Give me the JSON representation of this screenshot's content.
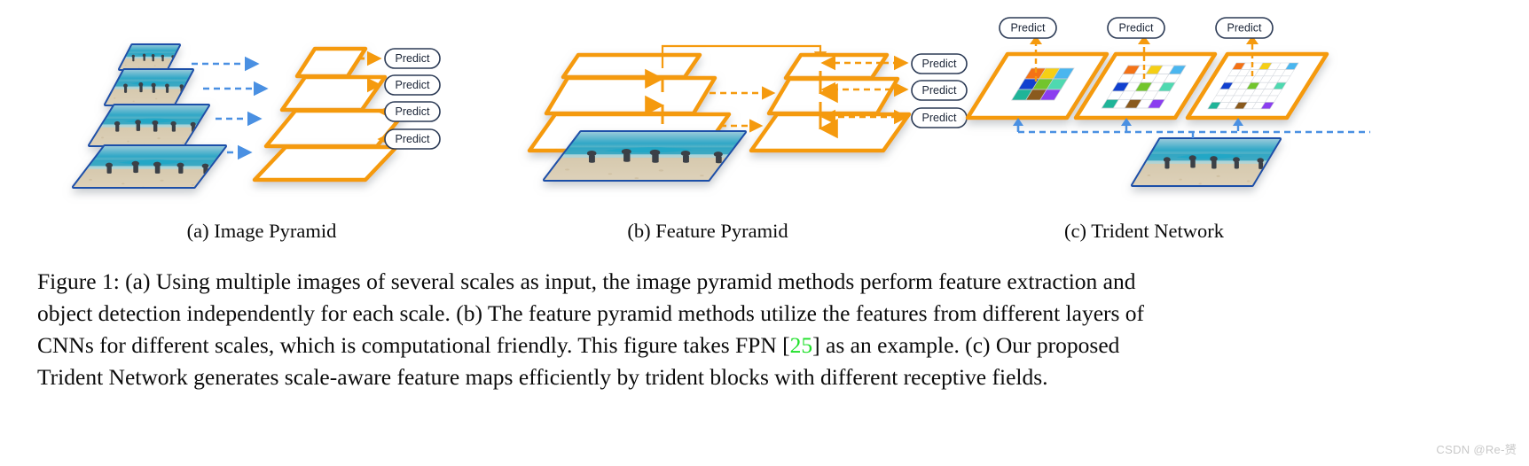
{
  "figure": {
    "subcaptions": [
      {
        "id": "a",
        "label": "(a) Image Pyramid"
      },
      {
        "id": "b",
        "label": "(b) Feature Pyramid"
      },
      {
        "id": "c",
        "label": "(c) Trident Network"
      }
    ],
    "caption": {
      "lines": [
        "Figure 1:  (a) Using multiple images of several scales as input, the image pyramid methods perform feature extraction and",
        "object detection independently for each scale.  (b) The feature pyramid methods utilize the features from different layers of",
        "CNNs for different scales, which is computational friendly.  This figure takes FPN [#CITE#] as an example.  (c) Our proposed",
        "Trident Network generates scale-aware feature maps efficiently by trident blocks with different receptive fields."
      ],
      "citation": "25",
      "citation_color": "#1fe02a"
    },
    "watermark": "CSDN @Re-赟",
    "predict_label": "Predict",
    "colors": {
      "image_plane_border": "#1f4fa8",
      "image_plane_border_dark": "#163f8c",
      "feature_plane_border": "#f59a0e",
      "feature_plane_fill": "#ffffff",
      "blue_arrow": "#4a90e2",
      "orange_arrow": "#f59a0e",
      "predict_border": "#2b3a55",
      "predict_text": "#1c2638",
      "grid_line": "#c9cdd4",
      "sand": "#d8cbb4",
      "sky": "#9fcbdc",
      "sea": "#35a8c4",
      "figure_dark": "#3b3f46"
    },
    "panel_a": {
      "name": "Image Pyramid",
      "image_planes": 4,
      "feature_planes": 4,
      "predict_count": 4,
      "arrows": "blue dashed image-to-feature, orange dashed feature-to-predict"
    },
    "panel_b": {
      "name": "Feature Pyramid",
      "image_planes": 1,
      "bottom_up_planes": 3,
      "top_down_planes": 3,
      "predict_count": 3,
      "arrows": "orange upward bottom-up, orange dashed lateral, orange downward top-down, orange dashed to predict"
    },
    "panel_c": {
      "name": "Trident Network",
      "image_planes": 1,
      "branches": 3,
      "predict_count": 3,
      "feature_maps": [
        {
          "branch": 1,
          "dilation": 1,
          "grid": 3,
          "cells": [
            {
              "row": 0,
              "col": 0,
              "color": "#f47216"
            },
            {
              "row": 0,
              "col": 1,
              "color": "#f5cf15"
            },
            {
              "row": 0,
              "col": 2,
              "color": "#4ab6ef"
            },
            {
              "row": 1,
              "col": 0,
              "color": "#1140cf"
            },
            {
              "row": 1,
              "col": 1,
              "color": "#72c52c"
            },
            {
              "row": 1,
              "col": 2,
              "color": "#4fd9b0"
            },
            {
              "row": 2,
              "col": 0,
              "color": "#1fb498"
            },
            {
              "row": 2,
              "col": 1,
              "color": "#8a5a1d"
            },
            {
              "row": 2,
              "col": 2,
              "color": "#8b3ef0"
            }
          ]
        },
        {
          "branch": 2,
          "dilation": 2,
          "grid": 5,
          "cells": [
            {
              "row": 0,
              "col": 0,
              "color": "#f47216"
            },
            {
              "row": 0,
              "col": 2,
              "color": "#f5cf15"
            },
            {
              "row": 0,
              "col": 4,
              "color": "#4ab6ef"
            },
            {
              "row": 2,
              "col": 0,
              "color": "#1140cf"
            },
            {
              "row": 2,
              "col": 2,
              "color": "#72c52c"
            },
            {
              "row": 2,
              "col": 4,
              "color": "#4fd9b0"
            },
            {
              "row": 4,
              "col": 0,
              "color": "#1fb498"
            },
            {
              "row": 4,
              "col": 2,
              "color": "#8a5a1d"
            },
            {
              "row": 4,
              "col": 4,
              "color": "#8b3ef0"
            }
          ]
        },
        {
          "branch": 3,
          "dilation": 3,
          "grid": 7,
          "cells": [
            {
              "row": 0,
              "col": 0,
              "color": "#f47216"
            },
            {
              "row": 0,
              "col": 3,
              "color": "#f5cf15"
            },
            {
              "row": 0,
              "col": 6,
              "color": "#4ab6ef"
            },
            {
              "row": 3,
              "col": 0,
              "color": "#1140cf"
            },
            {
              "row": 3,
              "col": 3,
              "color": "#72c52c"
            },
            {
              "row": 3,
              "col": 6,
              "color": "#4fd9b0"
            },
            {
              "row": 6,
              "col": 0,
              "color": "#1fb498"
            },
            {
              "row": 6,
              "col": 3,
              "color": "#8a5a1d"
            },
            {
              "row": 6,
              "col": 6,
              "color": "#8b3ef0"
            }
          ]
        }
      ]
    }
  }
}
